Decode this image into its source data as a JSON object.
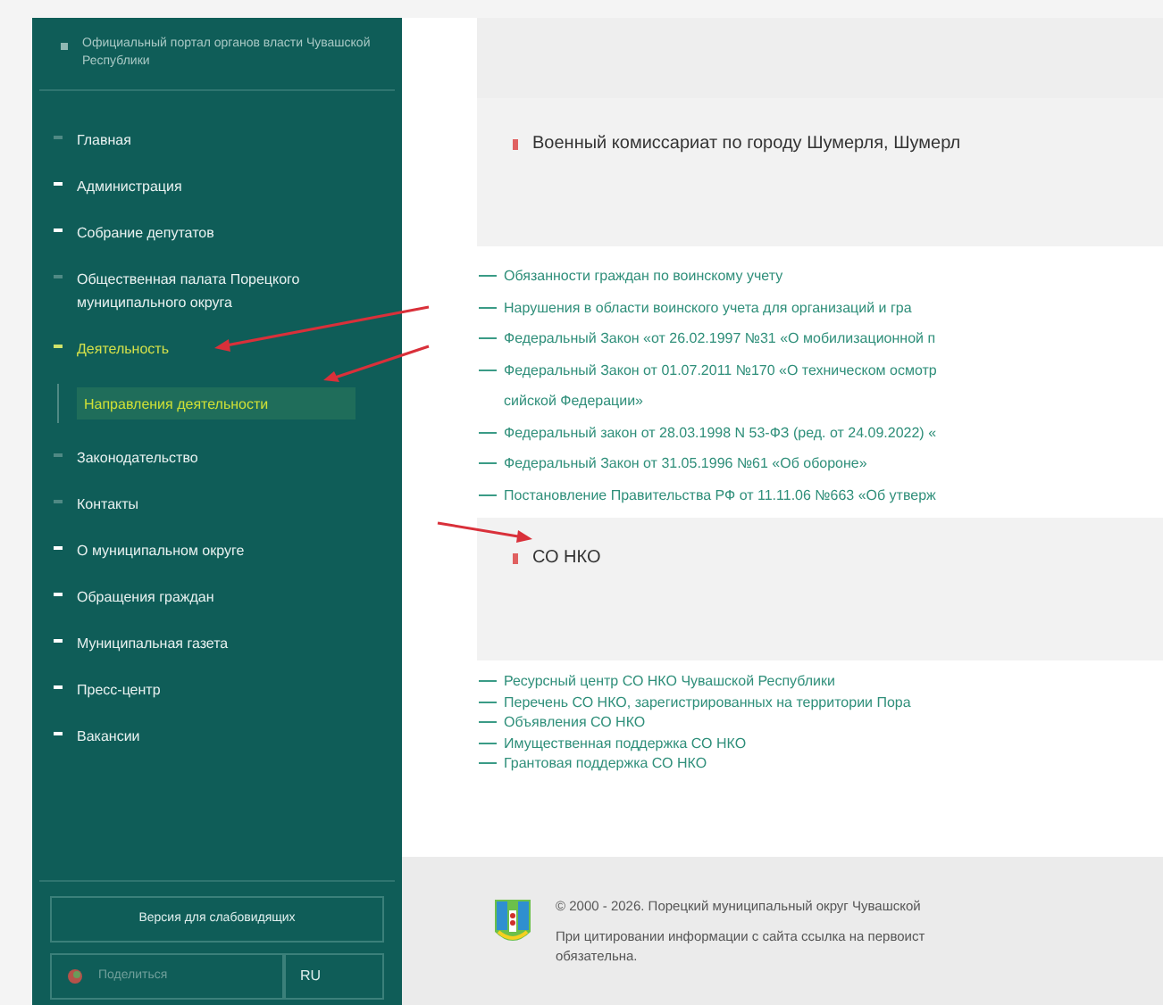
{
  "sidebar": {
    "header": "Официальный портал органов власти Чувашской Республики",
    "items": [
      {
        "label": "Главная",
        "kind": "link",
        "selected": false
      },
      {
        "label": "Администрация",
        "kind": "expandable",
        "expanded": false,
        "selected": false
      },
      {
        "label": "Собрание депутатов",
        "kind": "expandable",
        "expanded": false,
        "selected": false
      },
      {
        "label": "Общественная палата Порецкого муниципального округа",
        "kind": "link",
        "selected": false
      },
      {
        "label": "Деятельность",
        "kind": "expandable",
        "expanded": true,
        "selected": true,
        "children": [
          {
            "label": "Направления деятельности",
            "selected": true
          }
        ]
      },
      {
        "label": "Законодательство",
        "kind": "link",
        "selected": false
      },
      {
        "label": "Контакты",
        "kind": "link",
        "selected": false
      },
      {
        "label": "О муниципальном округе",
        "kind": "expandable",
        "expanded": false,
        "selected": false
      },
      {
        "label": "Обращения граждан",
        "kind": "expandable",
        "expanded": false,
        "selected": false
      },
      {
        "label": "Муниципальная газета",
        "kind": "expandable",
        "expanded": false,
        "selected": false
      },
      {
        "label": "Пресс-центр",
        "kind": "expandable",
        "expanded": false,
        "selected": false
      },
      {
        "label": "Вакансии",
        "kind": "expandable",
        "expanded": false,
        "selected": false
      }
    ],
    "accessibility_button": "Версия для слабовидящих",
    "share_label": "Поделиться",
    "language": "RU"
  },
  "sections": [
    {
      "title": "Военный комиссариат по городу Шумерля, Шумерл",
      "links": [
        {
          "kind": "item",
          "text": "Обязанности граждан по воинскому учету"
        },
        {
          "kind": "item",
          "text": "Нарушения в области воинского учета для организаций и гра"
        },
        {
          "kind": "item",
          "text": "Федеральный Закон «от 26.02.1997 №31 «О мобилизационной п"
        },
        {
          "kind": "item",
          "text": "Федеральный Закон от 01.07.2011 №170 «О техническом осмотр"
        },
        {
          "kind": "wrap",
          "text": "сийской Федерации»"
        },
        {
          "kind": "item",
          "text": "Федеральный закон от 28.03.1998 N 53-ФЗ (ред. от 24.09.2022) «"
        },
        {
          "kind": "item",
          "text": "Федеральный Закон от 31.05.1996 №61 «Об обороне»"
        },
        {
          "kind": "item",
          "text": "Постановление Правительства РФ от 11.11.06 №663 «Об утверж"
        }
      ]
    },
    {
      "title": "СО НКО",
      "links": [
        {
          "kind": "item",
          "text": "Ресурсный центр СО НКО Чувашской Республики"
        },
        {
          "kind": "item",
          "text": "Перечень СО НКО, зарегистрированных на территории Пора"
        },
        {
          "kind": "item",
          "text": "Объявления СО НКО"
        },
        {
          "kind": "item",
          "text": "Имущественная поддержка СО НКО"
        },
        {
          "kind": "item",
          "text": "Грантовая поддержка СО НКО"
        }
      ]
    }
  ],
  "footer": {
    "copyright": "© 2000 - 2026. Порецкий муниципальный округ Чувашской",
    "notice": "При цитировании информации с сайта ссылка на первоист",
    "notice_end": "обязательна."
  }
}
